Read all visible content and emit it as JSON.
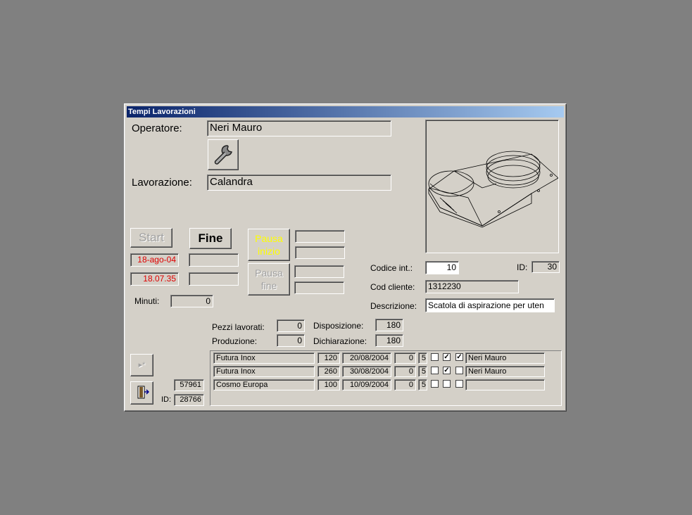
{
  "window": {
    "title": "Tempi Lavorazioni"
  },
  "form": {
    "operatore_label": "Operatore:",
    "operatore_value": "Neri Mauro",
    "lavorazione_label": "Lavorazione:",
    "lavorazione_value": "Calandra"
  },
  "timer": {
    "start_label": "Start",
    "fine_label": "Fine",
    "start_date": "18-ago-04",
    "start_time": "18.07.35",
    "end_date": "",
    "end_time": "",
    "pausa_inizio_label": "Pausa inizio",
    "pausa_fine_label": "Pausa fine",
    "minuti_label": "Minuti:",
    "minuti_value": "0"
  },
  "details": {
    "codice_int_label": "Codice  int.:",
    "codice_int_value": "10",
    "id_label": "ID:",
    "id_value": "30",
    "cod_cliente_label": "Cod cliente:",
    "cod_cliente_value": "1312230",
    "descrizione_label": "Descrizione:",
    "descrizione_value": "Scatola di aspirazione per uten"
  },
  "counts": {
    "pezzi_label": "Pezzi lavorati:",
    "pezzi_value": "0",
    "produzione_label": "Produzione:",
    "produzione_value": "0",
    "disposizione_label": "Disposizione:",
    "disposizione_value": "180",
    "dichiarazione_label": "Dichiarazione:",
    "dichiarazione_value": "180"
  },
  "footer": {
    "record_value": "57961",
    "id_label": "ID:",
    "id_value": "28766"
  },
  "rows": [
    {
      "cliente": "Futura Inox",
      "qty": "120",
      "date": "20/08/2004",
      "n1": "0",
      "n2": "5",
      "c1": false,
      "c2": true,
      "c3": true,
      "operatore": "Neri Mauro"
    },
    {
      "cliente": "Futura Inox",
      "qty": "260",
      "date": "30/08/2004",
      "n1": "0",
      "n2": "5",
      "c1": false,
      "c2": true,
      "c3": false,
      "operatore": "Neri Mauro"
    },
    {
      "cliente": "Cosmo Europa",
      "qty": "100",
      "date": "10/09/2004",
      "n1": "0",
      "n2": "5",
      "c1": false,
      "c2": false,
      "c3": false,
      "operatore": ""
    }
  ],
  "icons": [
    "wrench-icon",
    "new-record-icon",
    "exit-door-icon",
    "part-drawing"
  ],
  "colors": {
    "title_start": "#0a246a",
    "title_end": "#a6caf0",
    "red_text": "#e00000",
    "pausa_yellow": "#ffff00"
  }
}
